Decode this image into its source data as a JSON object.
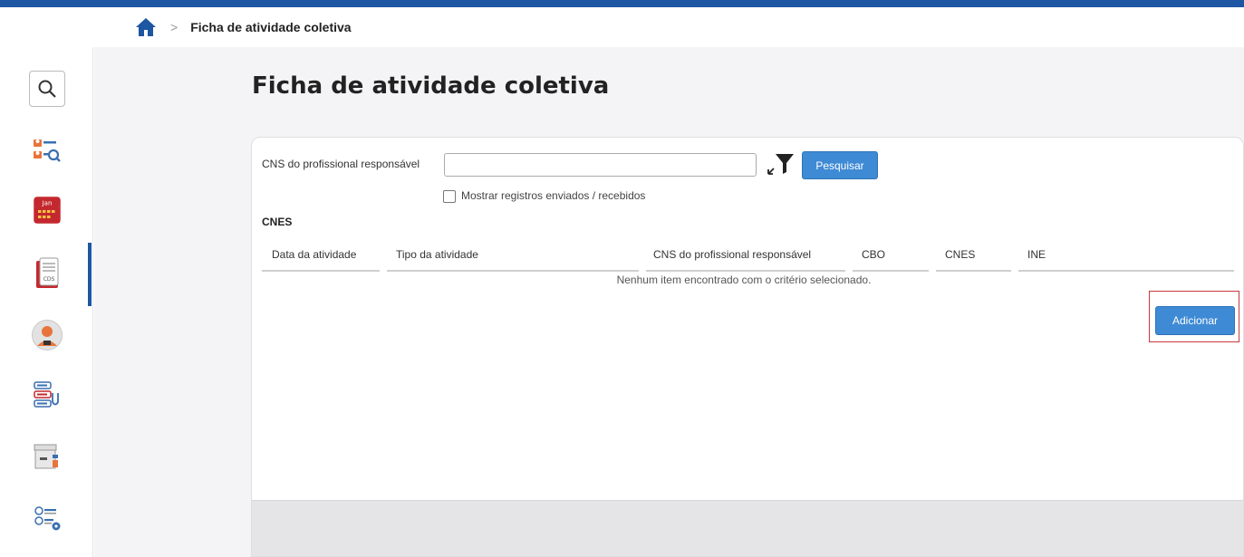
{
  "breadcrumb": {
    "separator": ">",
    "current": "Ficha de atividade coletiva"
  },
  "sidebar": {
    "items": [
      {
        "name": "search-icon"
      },
      {
        "name": "patient-search-icon"
      },
      {
        "name": "calendar-icon",
        "text": "Jan"
      },
      {
        "name": "cds-document-icon",
        "text": "CDS",
        "active": true
      },
      {
        "name": "user-avatar-icon"
      },
      {
        "name": "stethoscope-list-icon"
      },
      {
        "name": "archive-box-icon"
      },
      {
        "name": "settings-list-icon"
      }
    ]
  },
  "page": {
    "title": "Ficha de atividade coletiva"
  },
  "filter": {
    "cns_label": "CNS do profissional responsável",
    "cns_value": "",
    "search_button": "Pesquisar",
    "checkbox_label": "Mostrar registros enviados / recebidos",
    "checkbox_checked": false,
    "cnes_label": "CNES"
  },
  "table": {
    "columns": [
      "Data da atividade",
      "Tipo da atividade",
      "CNS do profissional responsável",
      "CBO",
      "CNES",
      "INE"
    ],
    "empty_message": "Nenhum item encontrado com o critério selecionado."
  },
  "actions": {
    "add_button": "Adicionar"
  },
  "colors": {
    "primary": "#1d56a2",
    "button": "#3e8ad4",
    "highlight": "#c9393f"
  }
}
